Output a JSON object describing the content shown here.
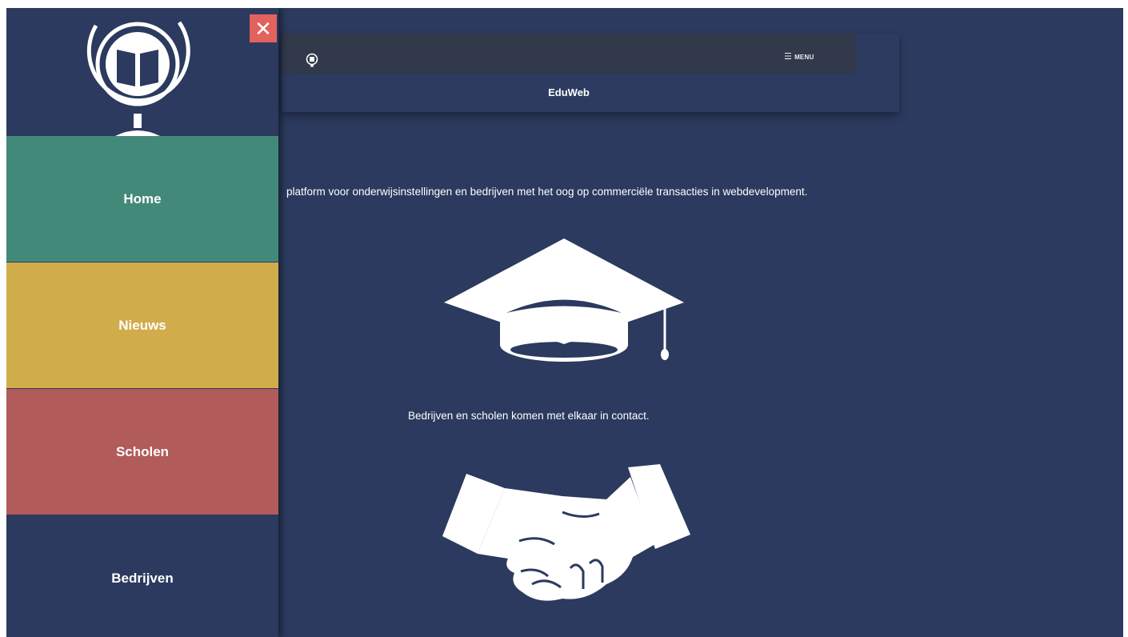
{
  "header": {
    "title": "EduWeb",
    "menu_label": "MENU",
    "menu_icon": "☰"
  },
  "close_icon": "✕",
  "main": {
    "intro": "platform voor onderwijsinstellingen en bedrijven met het oog op commerciële transacties in webdevelopment.",
    "tagline": "Bedrijven en scholen komen met elkaar in contact."
  },
  "sidebar": {
    "items": [
      {
        "label": "Home",
        "color": "#43897a"
      },
      {
        "label": "Nieuws",
        "color": "#d1ac4b"
      },
      {
        "label": "Scholen",
        "color": "#b15b5b"
      },
      {
        "label": "Bedrijven",
        "color": "#2b3a5e"
      }
    ]
  },
  "colors": {
    "background": "#2b3a5e",
    "header_bar": "#31394a",
    "close_button": "#e2625e"
  },
  "icons": [
    "globe-book-icon",
    "bulb-icon",
    "graduation-cap-icon",
    "handshake-icon",
    "close-icon",
    "menu-icon"
  ]
}
